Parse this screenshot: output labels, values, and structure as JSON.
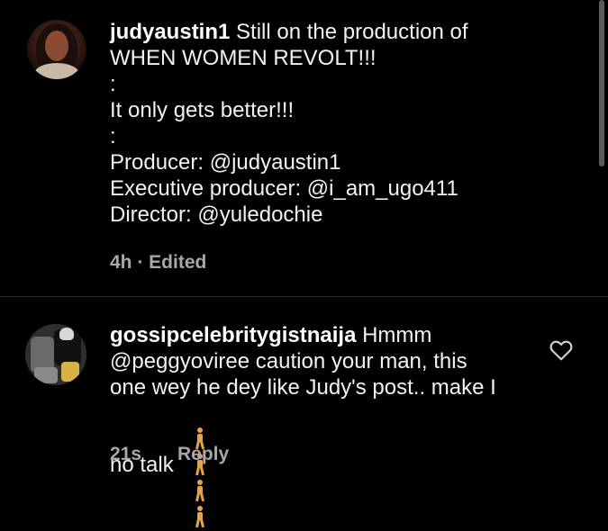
{
  "caption": {
    "username": "judyaustin1",
    "text": " Still on the production of\nWHEN WOMEN REVOLT!!!\n:\nIt only gets better!!!\n:\nProducer: @judyaustin1\nExecutive producer: @i_am_ugo411\nDirector: @yuledochie",
    "meta": "4h · Edited"
  },
  "comment": {
    "username": "gossipcelebritygistnaija",
    "text": " Hmmm\n@peggyoviree caution your man, this\none wey he dey like Judy's post.. make I\nno talk",
    "emoji_count": 4,
    "time": "21s",
    "reply_label": "Reply"
  },
  "colors": {
    "background": "#000000",
    "text": "#f2f2f2",
    "muted": "#a8a8a8",
    "divider": "#2a2a2a",
    "emoji": "#e8a24a"
  },
  "icons": {
    "like": "heart-outline-icon",
    "emoji": "person-walking-emoji"
  }
}
